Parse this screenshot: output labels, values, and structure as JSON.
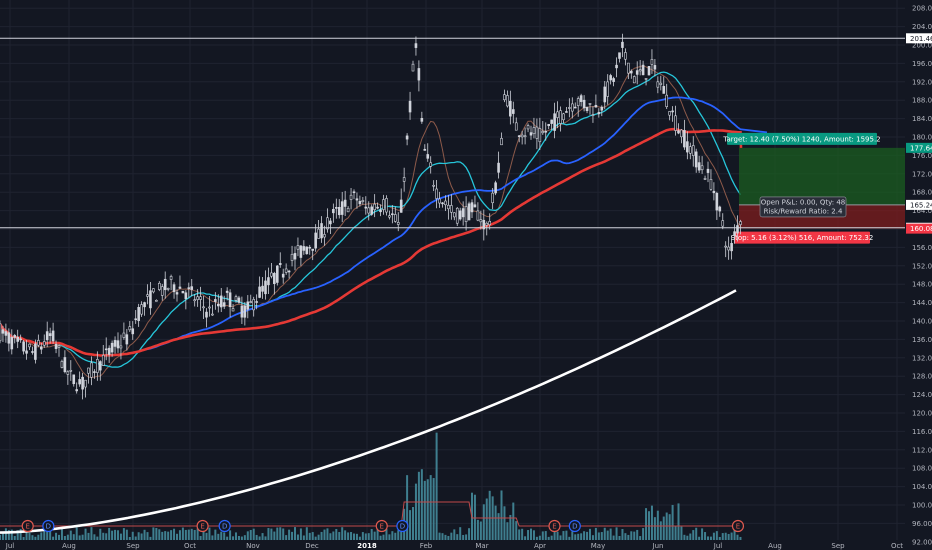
{
  "chart_data": {
    "type": "candlestick",
    "x_ticks": [
      "Jul",
      "Aug",
      "Sep",
      "Oct",
      "Nov",
      "Dec",
      "2018",
      "Feb",
      "Mar",
      "Apr",
      "May",
      "Jun",
      "Jul",
      "Aug",
      "Sep",
      "Oct"
    ],
    "y_ticks": [
      92,
      96,
      100,
      104,
      108,
      112,
      116,
      120,
      124,
      128,
      132,
      136,
      140,
      144,
      148,
      152,
      156,
      160,
      164,
      168,
      172,
      176,
      180,
      184,
      188,
      192,
      196,
      200,
      204,
      208
    ],
    "ylim": [
      90,
      210
    ],
    "horizontal_levels": [
      {
        "value": 201.46,
        "label": "201.46"
      },
      {
        "value": 160.27,
        "label": "160.27"
      }
    ],
    "price_tags": [
      {
        "value": 177.64,
        "label": "177.64",
        "color": "#089981"
      },
      {
        "value": 165.24,
        "label": "165.24",
        "color": "#ffffff"
      },
      {
        "value": 160.08,
        "label": "160.08",
        "color": "#f23645"
      }
    ],
    "position": {
      "entry": 165.24,
      "target_price": 177.64,
      "stop_price": 160.08,
      "target_label": "Target: 12.40 (7.50%) 1240, Amount: 1595.2",
      "stop_label": "Stop: 5.16 (3.12%) 516, Amount: 752.32",
      "pnl_label": "Open P&L: 0.00, Qty: 48",
      "rr_label": "Risk/Reward Ratio: 2.4"
    },
    "events": [
      {
        "type": "E",
        "month_index": 0.3
      },
      {
        "type": "D",
        "month_index": 0.65
      },
      {
        "type": "E",
        "month_index": 3.2
      },
      {
        "type": "D",
        "month_index": 3.55
      },
      {
        "type": "E",
        "month_index": 6.25
      },
      {
        "type": "D",
        "month_index": 6.6
      },
      {
        "type": "E",
        "month_index": 9.25
      },
      {
        "type": "D",
        "month_index": 9.6
      },
      {
        "type": "E",
        "month_index": 12.35
      }
    ],
    "colors": {
      "up": "#ffffff",
      "down": "#ffffff",
      "ma_fast": "#8d5a4a",
      "ma_cyan": "#26c6da",
      "ma_blue": "#2962ff",
      "ma_red": "#e53935",
      "ma_white": "#ffffff",
      "volume": "#3f7f8f",
      "vol_ma": "#c04a4a",
      "target_zone": "#1b5e20",
      "stop_zone": "#7f1d1d"
    }
  }
}
